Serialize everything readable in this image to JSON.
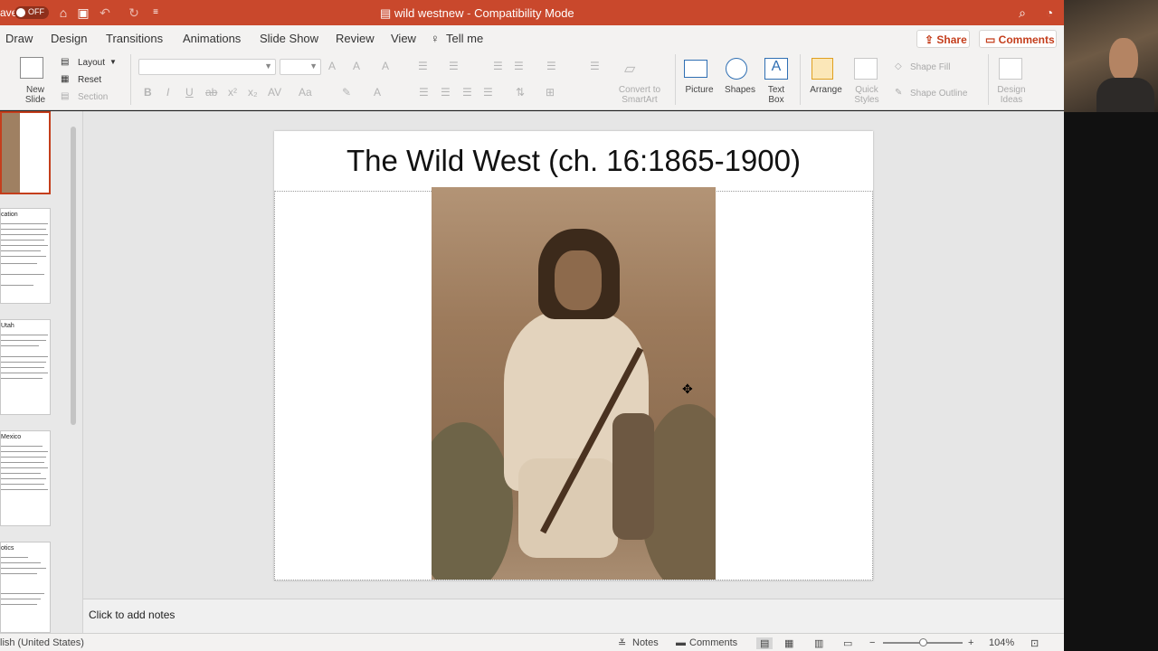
{
  "titlebar": {
    "autosave_label": "ave",
    "autosave_state": "OFF",
    "doc_name": "wild westnew",
    "separator": "-",
    "mode": "Compatibility Mode"
  },
  "tabs": [
    "Draw",
    "Design",
    "Transitions",
    "Animations",
    "Slide Show",
    "Review",
    "View",
    "Tell me"
  ],
  "share_label": "Share",
  "comments_label": "Comments",
  "ribbon": {
    "new_slide_line1": "New",
    "new_slide_line2": "Slide",
    "layout": "Layout",
    "reset": "Reset",
    "section": "Section",
    "convert_line1": "Convert to",
    "convert_line2": "SmartArt",
    "picture": "Picture",
    "shapes": "Shapes",
    "textbox_line1": "Text",
    "textbox_line2": "Box",
    "arrange": "Arrange",
    "quick_line1": "Quick",
    "quick_line2": "Styles",
    "shape_fill": "Shape Fill",
    "shape_outline": "Shape Outline",
    "design_line1": "Design",
    "design_line2": "Ideas"
  },
  "thumbnails": [
    {
      "title": ""
    },
    {
      "title": "cation"
    },
    {
      "title": "Utah"
    },
    {
      "title": "Mexico"
    },
    {
      "title": "otics"
    }
  ],
  "slide": {
    "title": "The Wild West (ch. 16:1865-1900)"
  },
  "notes_placeholder": "Click to add notes",
  "status": {
    "language": "lish (United States)",
    "notes": "Notes",
    "comments": "Comments",
    "zoom": "104%"
  },
  "colors": {
    "accent": "#c43e1c",
    "titlebar": "#c9482c"
  }
}
